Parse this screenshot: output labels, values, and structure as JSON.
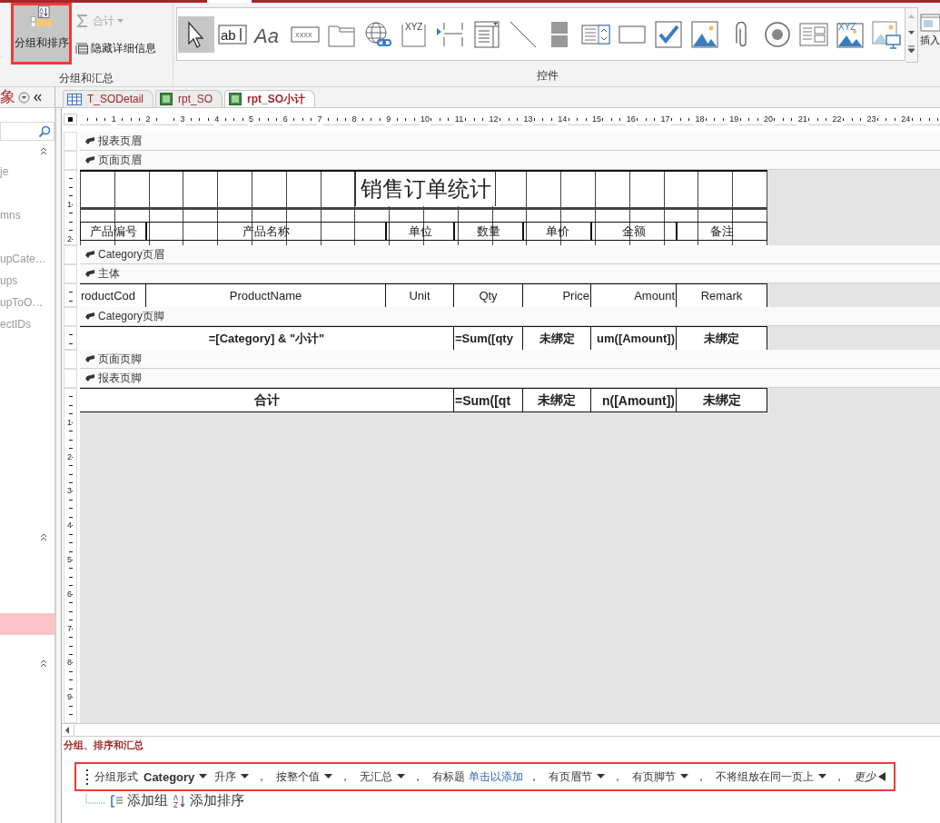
{
  "ribbon": {
    "groups": [
      {
        "label": "分组和汇总",
        "big_button": {
          "label": "分组和排序",
          "selected": true
        },
        "buttons": [
          {
            "kind": "sum",
            "label": "合计",
            "disabled": true
          },
          {
            "kind": "hide",
            "label": "隐藏详细信息",
            "disabled": false
          }
        ]
      },
      {
        "label": "控件",
        "gallery": [
          {
            "kind": "pointer",
            "selected": true
          },
          {
            "kind": "textbox",
            "glyph": "ab",
            "selected": false
          },
          {
            "kind": "label",
            "glyph": "Aa",
            "selected": false
          },
          {
            "kind": "button",
            "glyph": "XXXX",
            "selected": false
          },
          {
            "kind": "tab",
            "selected": false
          },
          {
            "kind": "hyperlink",
            "selected": false
          },
          {
            "kind": "navigation",
            "glyph": "XYZ",
            "selected": false
          },
          {
            "kind": "pagebreak",
            "selected": false
          },
          {
            "kind": "combo",
            "selected": false
          },
          {
            "kind": "line",
            "selected": false
          },
          {
            "kind": "toggle",
            "selected": false
          },
          {
            "kind": "listbox",
            "selected": false
          },
          {
            "kind": "rect",
            "selected": false
          },
          {
            "kind": "checkbox",
            "selected": false
          },
          {
            "kind": "image",
            "selected": false
          },
          {
            "kind": "attachment",
            "selected": false
          },
          {
            "kind": "option",
            "selected": false
          },
          {
            "kind": "subform",
            "selected": false
          },
          {
            "kind": "chart",
            "glyph": "XYZ",
            "selected": false
          },
          {
            "kind": "object",
            "selected": false
          }
        ]
      }
    ],
    "insert_label": "插入"
  },
  "nav": {
    "header": "象",
    "sections": [
      {
        "expanded": true,
        "items": [
          {
            "label": "je",
            "selected": false
          },
          {
            "label": "mns",
            "selected": false
          },
          {
            "label": "upCate…",
            "selected": false
          },
          {
            "label": "ups",
            "selected": false
          },
          {
            "label": "upToO…",
            "selected": false
          },
          {
            "label": "ectIDs",
            "selected": false
          }
        ]
      },
      {
        "expanded": true,
        "items": [
          {
            "selected": true
          }
        ]
      },
      {
        "expanded": true
      }
    ]
  },
  "tabs": [
    {
      "label": "T_SODetail",
      "kind": "table",
      "selected": false
    },
    {
      "label": "rpt_SO",
      "kind": "report",
      "selected": false
    },
    {
      "label": "rpt_SO小计",
      "kind": "report",
      "selected": true
    }
  ],
  "ruler": {
    "marks": [
      "1",
      "2",
      "3",
      "4",
      "5",
      "6",
      "7",
      "8",
      "9",
      "10",
      "11",
      "12",
      "13",
      "14",
      "15",
      "16",
      "17",
      "18",
      "19",
      "20",
      "21",
      "22",
      "23",
      "24"
    ]
  },
  "report": {
    "sections": [
      {
        "label": "报表页眉",
        "kind": "empty"
      },
      {
        "label": "页面页眉",
        "kind": "page_header",
        "ruler_marks": [
          "1",
          "2"
        ],
        "title": "销售订单统计",
        "headings": [
          "产品编号",
          "产品名称",
          "单位",
          "数量",
          "单价",
          "金额",
          "备注"
        ]
      },
      {
        "label": "Category页眉",
        "kind": "empty"
      },
      {
        "label": "主体",
        "kind": "detail",
        "cells": [
          {
            "text": "roductCod"
          },
          {
            "text": "ProductName"
          },
          {
            "text": "Unit"
          },
          {
            "text": "Qty"
          },
          {
            "text": "Price"
          },
          {
            "text": "Amount"
          },
          {
            "text": "Remark"
          }
        ]
      },
      {
        "label": "Category页脚",
        "kind": "subtotal",
        "cells": [
          {
            "text": "=[Category] & \"小计\""
          },
          {
            "text": "=Sum([qty"
          },
          {
            "text": "未绑定"
          },
          {
            "text": "um([Amount])"
          },
          {
            "text": "未绑定"
          }
        ]
      },
      {
        "label": "页面页脚",
        "kind": "empty"
      },
      {
        "label": "报表页脚",
        "kind": "total",
        "ruler_marks": [
          "1",
          "2",
          "3",
          "4",
          "5",
          "6",
          "7",
          "8",
          "9"
        ],
        "cells": [
          {
            "text": "合计"
          },
          {
            "text": "=Sum([qt"
          },
          {
            "text": "未绑定"
          },
          {
            "text": "n([Amount])"
          },
          {
            "text": "未绑定"
          }
        ]
      }
    ]
  },
  "grouping": {
    "title": "分组、排序和汇总",
    "row": {
      "prefix": "分组形式",
      "field": "Category",
      "options": [
        {
          "kind": "dropdown",
          "label": "升序",
          "sep": "，"
        },
        {
          "kind": "dropdown",
          "label": "按整个值",
          "sep": "，"
        },
        {
          "kind": "dropdown",
          "label": "无汇总",
          "sep": "，"
        },
        {
          "kind": "link",
          "label": "有标题",
          "link": "单击以添加",
          "sep": "，"
        },
        {
          "kind": "dropdown",
          "label": "有页眉节",
          "sep": "，"
        },
        {
          "kind": "dropdown",
          "label": "有页脚节",
          "sep": "，"
        },
        {
          "kind": "dropdown",
          "label": "不将组放在同一页上",
          "sep": "，"
        }
      ],
      "less": "更少"
    },
    "add_group": "添加组",
    "add_sort": "添加排序"
  }
}
